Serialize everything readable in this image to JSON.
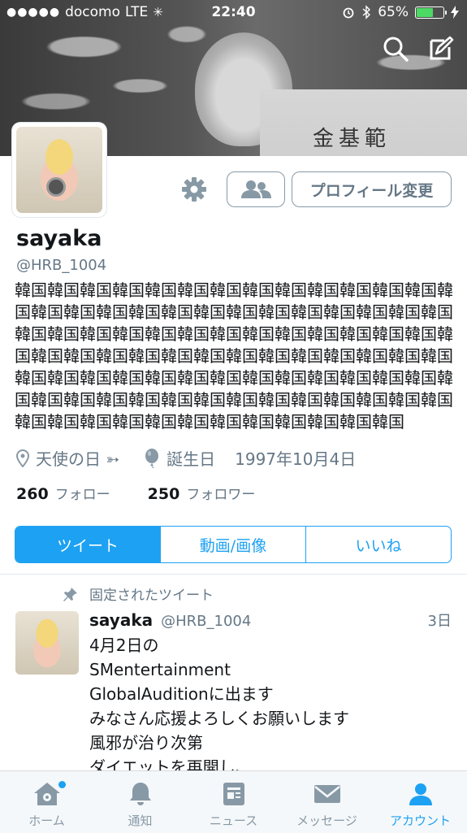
{
  "status_bar": {
    "signal_dots": "●●●●●",
    "carrier": "docomo",
    "network": "LTE",
    "time": "22:40",
    "battery_percent": "65%",
    "battery_level": 0.65
  },
  "header": {
    "banner_text": "金基範",
    "search_icon": "search-icon",
    "compose_icon": "compose-icon"
  },
  "profile": {
    "name": "sayaka",
    "handle": "@HRB_1004",
    "bio": "韓国韓国韓国韓国韓国韓国韓国韓国韓国韓国韓国韓国韓国韓国韓国韓国韓国韓国韓国韓国韓国韓国韓国韓国韓国韓国韓国韓国韓国韓国韓国韓国韓国韓国韓国韓国韓国韓国韓国韓国韓国韓国韓国韓国韓国韓国韓国韓国韓国韓国韓国韓国韓国韓国韓国韓国韓国韓国韓国韓国韓国韓国韓国韓国韓国韓国韓国韓国韓国韓国韓国韓国韓国韓国韓国韓国韓国韓国韓国韓国韓国韓国韓国韓国韓国韓国韓国韓国韓国韓国韓国韓国韓国",
    "location": "天使の日 ➳",
    "birthday_label": "誕生日",
    "birthday": "1997年10月4日",
    "following_count": "260",
    "following_label": "フォロー",
    "followers_count": "250",
    "followers_label": "フォロワー"
  },
  "actions": {
    "edit_profile": "プロフィール変更"
  },
  "tabs": [
    {
      "label": "ツイート",
      "active": true
    },
    {
      "label": "動画/画像",
      "active": false
    },
    {
      "label": "いいね",
      "active": false
    }
  ],
  "pinned_tweet": {
    "pinned_label": "固定されたツイート",
    "name": "sayaka",
    "handle": "@HRB_1004",
    "time": "3日",
    "text": "4月2日の\nSMentertainment\nGlobalAuditionに出ます\nみなさん応援よろしくお願いします\n風邪が治り次第\nダイエットを再開し、"
  },
  "bottom_nav": [
    {
      "label": "ホーム",
      "icon": "home-icon",
      "active": false
    },
    {
      "label": "通知",
      "icon": "bell-icon",
      "active": false
    },
    {
      "label": "ニュース",
      "icon": "news-icon",
      "active": false
    },
    {
      "label": "メッセージ",
      "icon": "envelope-icon",
      "active": false
    },
    {
      "label": "アカウント",
      "icon": "person-icon",
      "active": true
    }
  ],
  "colors": {
    "accent": "#1da1f2",
    "muted": "#657786",
    "battery": "#4cd964"
  }
}
